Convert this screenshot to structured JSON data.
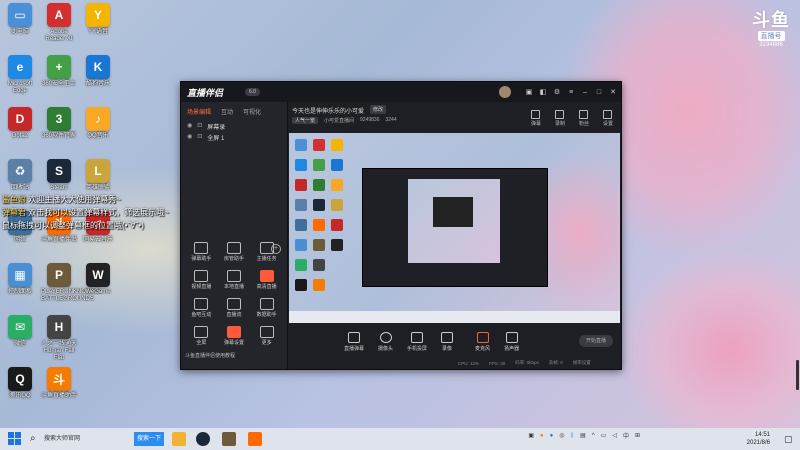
{
  "desktop": {
    "icons": [
      {
        "label": "此电脑",
        "color": "#4a90d9",
        "glyph": "▭"
      },
      {
        "label": "Adobe Reader XI",
        "color": "#d32f2f",
        "glyph": "A"
      },
      {
        "label": "YY语音",
        "color": "#f5b400",
        "glyph": "Y"
      },
      {
        "label": "Microsoft Edge",
        "color": "#1e88e5",
        "glyph": "e"
      },
      {
        "label": "360安全卫士",
        "color": "#43a047",
        "glyph": "+"
      },
      {
        "label": "酷狗音乐",
        "color": "#1976d2",
        "glyph": "K"
      },
      {
        "label": "Dota2",
        "color": "#c62828",
        "glyph": "D"
      },
      {
        "label": "360软件管家",
        "color": "#2e7d32",
        "glyph": "3"
      },
      {
        "label": "QQ音乐",
        "color": "#f9a825",
        "glyph": "♪"
      },
      {
        "label": "回收站",
        "color": "#5c7fa8",
        "glyph": "♻"
      },
      {
        "label": "Steam",
        "color": "#1b2838",
        "glyph": "S"
      },
      {
        "label": "英雄联盟",
        "color": "#c9a53c",
        "glyph": "L"
      },
      {
        "label": "网络",
        "color": "#3d6e9e",
        "glyph": "⌂"
      },
      {
        "label": "斗鱼直播伴侣",
        "color": "#ff6a00",
        "glyph": "斗"
      },
      {
        "label": "网易云音乐",
        "color": "#c62828",
        "glyph": "♫"
      },
      {
        "label": "控制面板",
        "color": "#4a8fd4",
        "glyph": "▦"
      },
      {
        "label": "PLAYERUNKNOWN'S BATTLEGROUNDS",
        "color": "#6d5a3a",
        "glyph": "P"
      },
      {
        "label": "WeGame",
        "color": "#222222",
        "glyph": "W"
      },
      {
        "label": "微信",
        "color": "#2aae67",
        "glyph": "✉"
      },
      {
        "label": "人之一线通天 Human Fall Flat",
        "color": "#444444",
        "glyph": "H"
      },
      {
        "label": "腾讯QQ",
        "color": "#1a1a1a",
        "glyph": "Q"
      },
      {
        "label": "斗鱼直播助手",
        "color": "#f57c00",
        "glyph": "斗"
      }
    ]
  },
  "danmu": [
    {
      "name": "鲨鱼娘",
      "text": "欢迎主播大大使用弹幕秀~"
    },
    {
      "name": "弹幕君",
      "text": "双击我可以设置弹幕样式，筛选展示哦~"
    },
    {
      "name": "",
      "text": "鼠标拖拽可以调整弹幕框的位置哦(•ˇ∀ˇ•)"
    }
  ],
  "logo": {
    "big": "斗鱼",
    "sub": "直播号",
    "id": "3234886"
  },
  "window": {
    "brand": "直播伴侣",
    "version": "6.0",
    "left_tabs": [
      "场景编辑",
      "互动",
      "可视化"
    ],
    "scenes": [
      "屏幕录",
      "全屏 1"
    ],
    "tools": [
      {
        "label": "弹幕助手"
      },
      {
        "label": "房管助手"
      },
      {
        "label": "主播任务"
      },
      {
        "label": "视频直播"
      },
      {
        "label": "本地直播"
      },
      {
        "label": "高清直播"
      },
      {
        "label": "鱼吧互动"
      },
      {
        "label": "直播流"
      },
      {
        "label": "数据助手"
      },
      {
        "label": "全屏"
      },
      {
        "label": "弹幕设置"
      },
      {
        "label": "更多"
      }
    ],
    "add_more": "+",
    "template_hint": "斗鱼直播伴侣使用教程",
    "live_title": "今天也是伸伸乐乐的小可爱",
    "edit_label": "修改",
    "metrics": {
      "tag": "人气一览",
      "room": "小可爱直播间",
      "id": "9249836",
      "count": "3244"
    },
    "right_tools": [
      "弹幕",
      "录制",
      "粉丝",
      "设置"
    ],
    "controls": [
      "直播弹幕",
      "摄像头",
      "手机投屏",
      "录像",
      "麦克风",
      "扬声器"
    ],
    "start_btn": "开始直播",
    "status": [
      "CPU: 12%",
      "FPS: 30",
      "码率: 0kbps",
      "丢帧: 0",
      "帧率设置"
    ]
  },
  "taskbar": {
    "search_placeholder": "搜索大师官网",
    "search_button": "搜索一下",
    "time": "14:51",
    "date": "2021/8/6",
    "ime": "中"
  }
}
